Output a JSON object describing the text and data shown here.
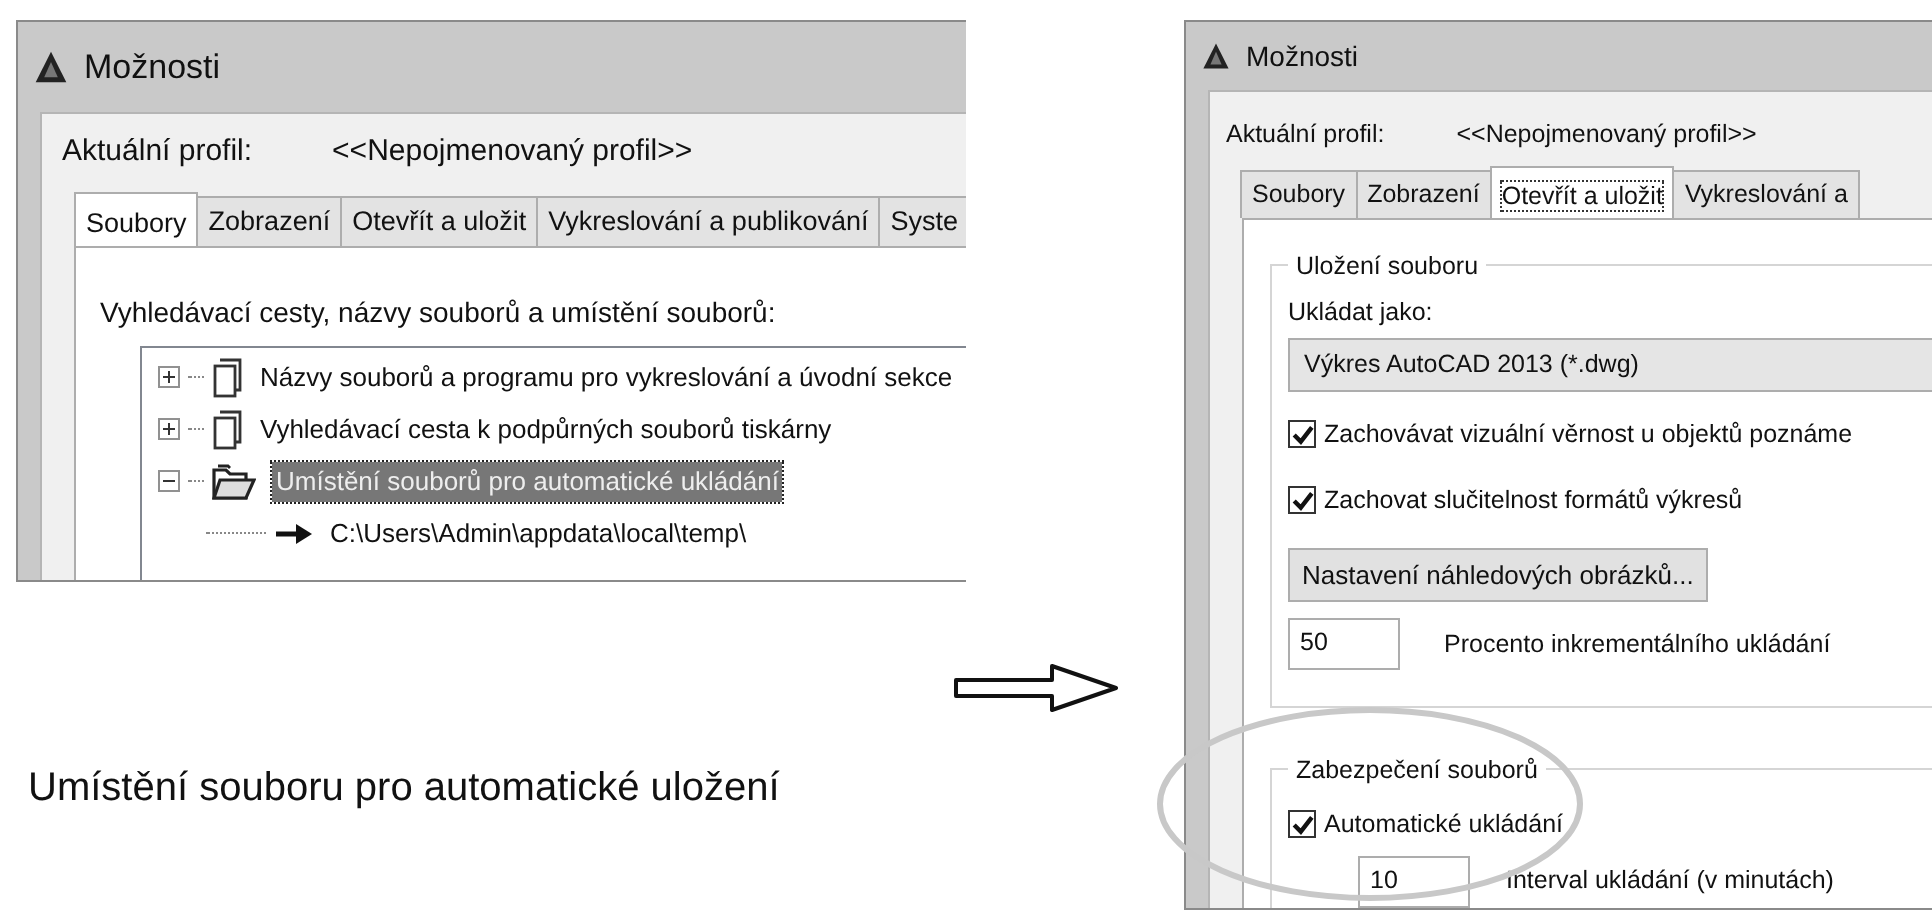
{
  "left_screenshot": {
    "window": {
      "title": "Možnosti"
    },
    "profile_label": "Aktuální profil:",
    "profile_value": "<<Nepojmenovaný profil>>",
    "tabs": [
      {
        "label": "Soubory",
        "selected": true
      },
      {
        "label": "Zobrazení",
        "selected": false
      },
      {
        "label": "Otevřít a uložit",
        "selected": false
      },
      {
        "label": "Vykreslování a publikování",
        "selected": false
      },
      {
        "label": "Syste",
        "selected": false
      }
    ],
    "section_label": "Vyhledávací cesty, názvy souborů a umístění souborů:",
    "tree": [
      {
        "label": "Názvy souborů a programu pro vykreslování a úvodní sekce",
        "kind": "files",
        "expanded": false,
        "selected": false
      },
      {
        "label": "Vyhledávací cesta k podpůrných souborů tiskárny",
        "kind": "files",
        "expanded": false,
        "selected": false
      },
      {
        "label": "Umístění souborů pro automatické ukládání",
        "kind": "folder",
        "expanded": true,
        "selected": true,
        "children": [
          {
            "label": "C:\\Users\\Admin\\appdata\\local\\temp\\",
            "kind": "path",
            "selected": false
          }
        ]
      }
    ]
  },
  "caption": "Umístění souboru pro automatické uložení",
  "right_screenshot": {
    "window": {
      "title": "Možnosti"
    },
    "profile_label": "Aktuální profil:",
    "profile_value": "<<Nepojmenovaný profil>>",
    "tabs": [
      {
        "label": "Soubory",
        "selected": false
      },
      {
        "label": "Zobrazení",
        "selected": false
      },
      {
        "label": "Otevřít a uložit",
        "selected": true
      },
      {
        "label": "Vykreslování a",
        "selected": false
      }
    ],
    "save_group": {
      "title": "Uložení souboru",
      "save_as_label": "Ukládat jako:",
      "save_as_value": "Výkres AutoCAD 2013 (*.dwg)",
      "checkboxes": [
        {
          "label": "Zachovávat vizuální věrnost u objektů poznáme",
          "checked": true
        },
        {
          "label": "Zachovat  slučitelnost formátů výkresů",
          "checked": true
        }
      ],
      "thumbnail_button": "Nastavení náhledových obrázků...",
      "incremental_value": "50",
      "incremental_label": "Procento inkrementálního ukládání"
    },
    "safety_group": {
      "title": "Zabezpečení souborů",
      "checkboxes": [
        {
          "label": "Automatické ukládání",
          "checked": true
        }
      ],
      "interval_value": "10",
      "interval_label": "Interval ukládání (v minutách)"
    }
  }
}
